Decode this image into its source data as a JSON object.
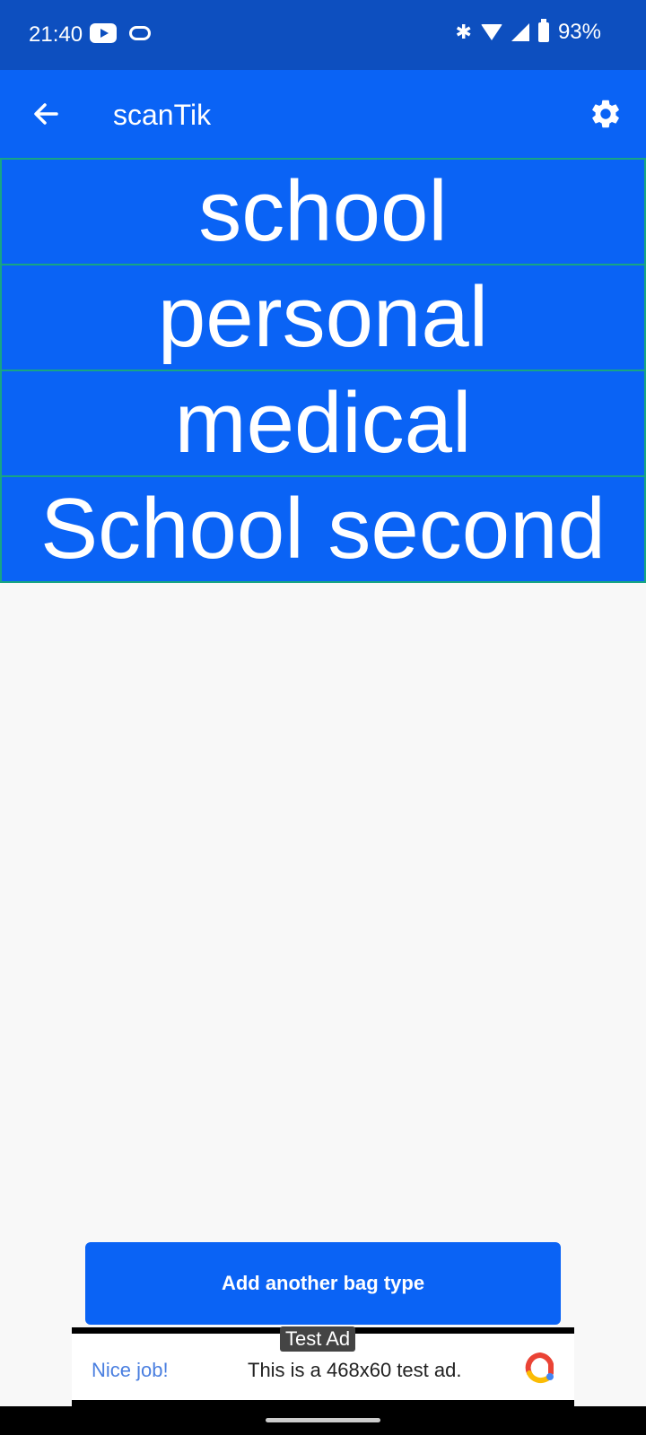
{
  "status_bar": {
    "time": "21:40",
    "battery_percent": "93%",
    "icons": [
      "youtube-icon",
      "pill-icon",
      "bluetooth-icon",
      "wifi-icon",
      "signal-icon",
      "battery-charging-icon"
    ]
  },
  "app_bar": {
    "title": "scanTik",
    "back_icon": "arrow-left-icon",
    "settings_icon": "gear-icon"
  },
  "bag_types": [
    {
      "label": "school"
    },
    {
      "label": "personal"
    },
    {
      "label": "medical"
    },
    {
      "label": "School second"
    }
  ],
  "actions": {
    "add_label": "Add another bag type"
  },
  "ad": {
    "label": "Test Ad",
    "headline": "Nice job!",
    "body": "This is a 468x60 test ad."
  },
  "colors": {
    "status_bar": "#0d4fbf",
    "primary": "#0a63f5",
    "item_border": "#17a584",
    "background": "#f8f8f8"
  }
}
